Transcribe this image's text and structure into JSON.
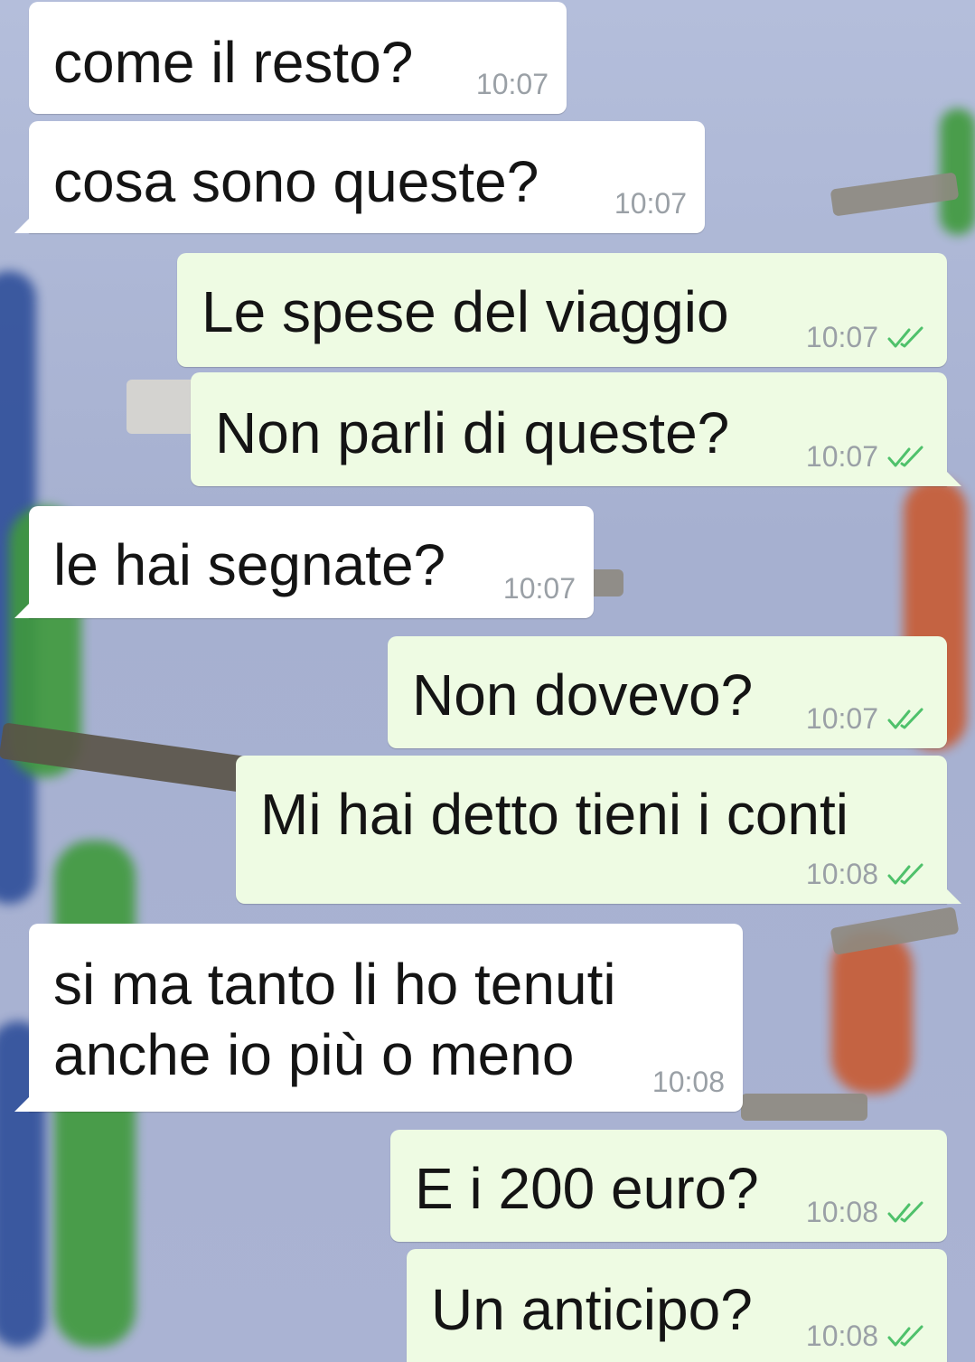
{
  "messages": [
    {
      "text": "come il resto?",
      "time": "10:07",
      "direction": "incoming"
    },
    {
      "text": "cosa sono queste?",
      "time": "10:07",
      "direction": "incoming"
    },
    {
      "text": "Le spese del viaggio",
      "time": "10:07",
      "direction": "outgoing",
      "status": "double-check-icon"
    },
    {
      "text": "Non parli di queste?",
      "time": "10:07",
      "direction": "outgoing",
      "status": "double-check-icon"
    },
    {
      "text": "le hai segnate?",
      "time": "10:07",
      "direction": "incoming"
    },
    {
      "text": "Non dovevo?",
      "time": "10:07",
      "direction": "outgoing",
      "status": "double-check-icon"
    },
    {
      "text": "Mi hai detto tieni i conti",
      "time": "10:08",
      "direction": "outgoing",
      "status": "double-check-icon"
    },
    {
      "text": "si ma tanto li ho tenuti\nanche io più o meno",
      "time": "10:08",
      "direction": "incoming"
    },
    {
      "text": "E i 200 euro?",
      "time": "10:08",
      "direction": "outgoing",
      "status": "double-check-icon"
    },
    {
      "text": "Un anticipo?",
      "time": "10:08",
      "direction": "outgoing",
      "status": "double-check-icon"
    }
  ],
  "colors": {
    "incoming_bubble": "#ffffff",
    "outgoing_bubble": "#eefbe3",
    "timestamp": "#9aa0a6",
    "read_ticks": "#4fc16b"
  }
}
